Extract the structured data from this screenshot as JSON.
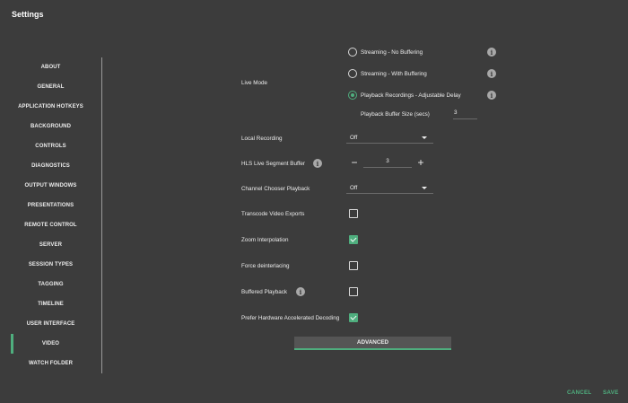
{
  "window": {
    "title": "Settings"
  },
  "sidebar": {
    "items": [
      {
        "label": "ABOUT",
        "active": false
      },
      {
        "label": "GENERAL",
        "active": false
      },
      {
        "label": "APPLICATION HOTKEYS",
        "active": false
      },
      {
        "label": "BACKGROUND",
        "active": false
      },
      {
        "label": "CONTROLS",
        "active": false
      },
      {
        "label": "DIAGNOSTICS",
        "active": false
      },
      {
        "label": "OUTPUT WINDOWS",
        "active": false
      },
      {
        "label": "PRESENTATIONS",
        "active": false
      },
      {
        "label": "REMOTE CONTROL",
        "active": false
      },
      {
        "label": "SERVER",
        "active": false
      },
      {
        "label": "SESSION TYPES",
        "active": false
      },
      {
        "label": "TAGGING",
        "active": false
      },
      {
        "label": "TIMELINE",
        "active": false
      },
      {
        "label": "USER INTERFACE",
        "active": false
      },
      {
        "label": "VIDEO",
        "active": true
      },
      {
        "label": "WATCH FOLDER",
        "active": false
      }
    ]
  },
  "video": {
    "live_mode": {
      "label": "Live Mode",
      "options": [
        {
          "label": "Streaming - No Buffering",
          "selected": false
        },
        {
          "label": "Streaming - With Buffering",
          "selected": false
        },
        {
          "label": "Playback Recordings - Adjustable Delay",
          "selected": true
        }
      ],
      "buffer_size_label": "Playback Buffer Size (secs)",
      "buffer_size_value": "3"
    },
    "local_recording": {
      "label": "Local Recording",
      "value": "Off"
    },
    "hls_buffer": {
      "label": "HLS Live Segment Buffer",
      "value": "3",
      "minus": "−",
      "plus": "+"
    },
    "channel_chooser": {
      "label": "Channel Chooser Playback",
      "value": "Off"
    },
    "transcode": {
      "label": "Transcode Video Exports",
      "checked": false
    },
    "zoom_interp": {
      "label": "Zoom Interpolation",
      "checked": true
    },
    "force_deinterlace": {
      "label": "Force deinterlacing",
      "checked": false
    },
    "buffered_playback": {
      "label": "Buffered Playback",
      "checked": false
    },
    "hw_decoding": {
      "label": "Prefer Hardware Accelerated Decoding",
      "checked": true
    },
    "advanced_label": "ADVANCED",
    "info_glyph": "i"
  },
  "footer": {
    "cancel_label": "CANCEL",
    "save_label": "SAVE"
  },
  "colors": {
    "background": "#3c3c3c",
    "accent": "#4fae7e",
    "text": "#ececec"
  }
}
